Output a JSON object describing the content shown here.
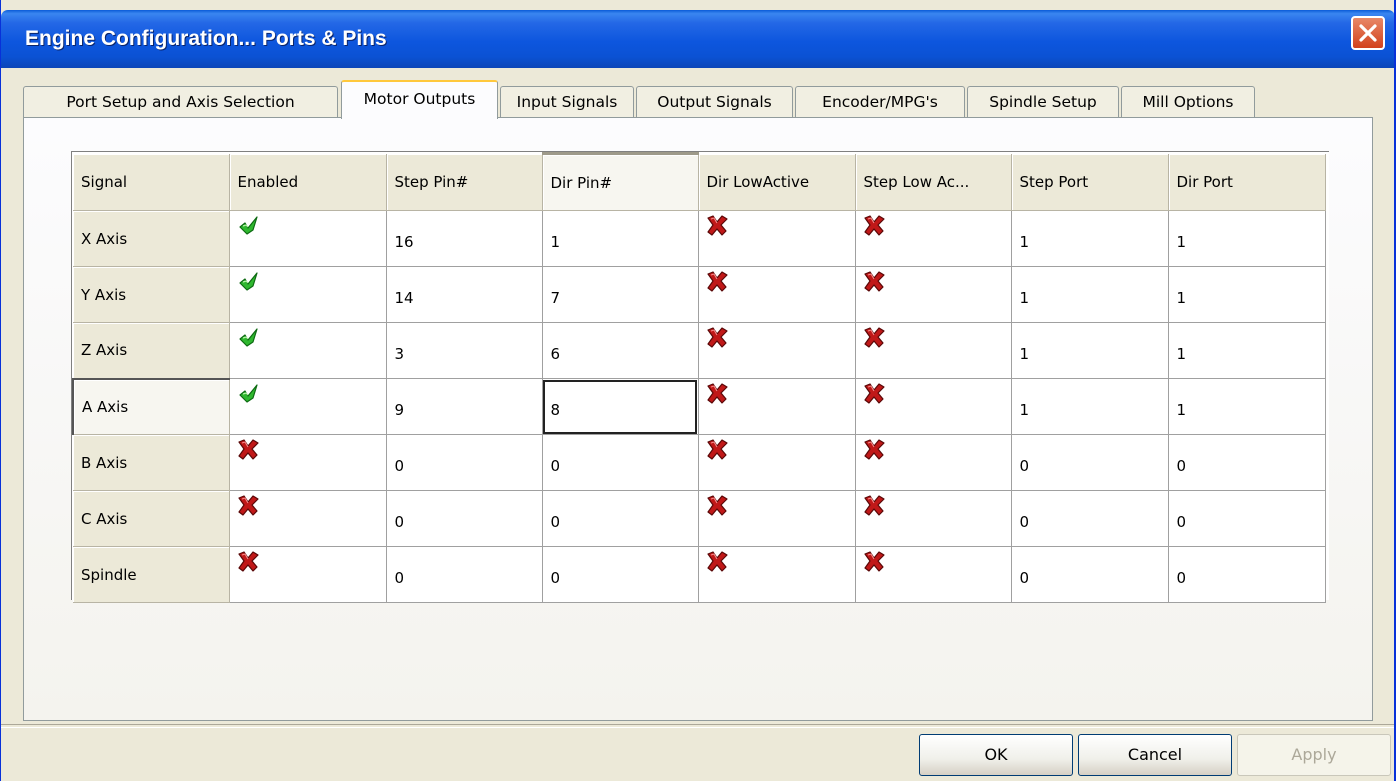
{
  "window": {
    "title": "Engine Configuration... Ports & Pins"
  },
  "tabs": [
    {
      "label": "Port Setup and Axis Selection",
      "active": false
    },
    {
      "label": "Motor Outputs",
      "active": true
    },
    {
      "label": "Input Signals",
      "active": false
    },
    {
      "label": "Output Signals",
      "active": false
    },
    {
      "label": "Encoder/MPG's",
      "active": false
    },
    {
      "label": "Spindle Setup",
      "active": false
    },
    {
      "label": "Mill Options",
      "active": false
    }
  ],
  "grid": {
    "columns": [
      "Signal",
      "Enabled",
      "Step Pin#",
      "Dir Pin#",
      "Dir LowActive",
      "Step Low Ac...",
      "Step Port",
      "Dir Port"
    ],
    "rows": [
      {
        "signal": "X Axis",
        "enabled": "check",
        "step_pin": "16",
        "dir_pin": "1",
        "dir_low_active": "x",
        "step_low_active": "x",
        "step_port": "1",
        "dir_port": "1"
      },
      {
        "signal": "Y Axis",
        "enabled": "check",
        "step_pin": "14",
        "dir_pin": "7",
        "dir_low_active": "x",
        "step_low_active": "x",
        "step_port": "1",
        "dir_port": "1"
      },
      {
        "signal": "Z Axis",
        "enabled": "check",
        "step_pin": "3",
        "dir_pin": "6",
        "dir_low_active": "x",
        "step_low_active": "x",
        "step_port": "1",
        "dir_port": "1"
      },
      {
        "signal": "A Axis",
        "enabled": "check",
        "step_pin": "9",
        "dir_pin": "8",
        "dir_low_active": "x",
        "step_low_active": "x",
        "step_port": "1",
        "dir_port": "1"
      },
      {
        "signal": "B Axis",
        "enabled": "x",
        "step_pin": "0",
        "dir_pin": "0",
        "dir_low_active": "x",
        "step_low_active": "x",
        "step_port": "0",
        "dir_port": "0"
      },
      {
        "signal": "C Axis",
        "enabled": "x",
        "step_pin": "0",
        "dir_pin": "0",
        "dir_low_active": "x",
        "step_low_active": "x",
        "step_port": "0",
        "dir_port": "0"
      },
      {
        "signal": "Spindle",
        "enabled": "x",
        "step_pin": "0",
        "dir_pin": "0",
        "dir_low_active": "x",
        "step_low_active": "x",
        "step_port": "0",
        "dir_port": "0"
      }
    ],
    "icons": {
      "check": "green-check-icon",
      "x": "red-x-icon"
    }
  },
  "buttons": {
    "ok": "OK",
    "cancel": "Cancel",
    "apply": "Apply"
  },
  "colors": {
    "titlebar": "#0b52d4",
    "check": "#2fb82f",
    "x": "#c01818"
  }
}
